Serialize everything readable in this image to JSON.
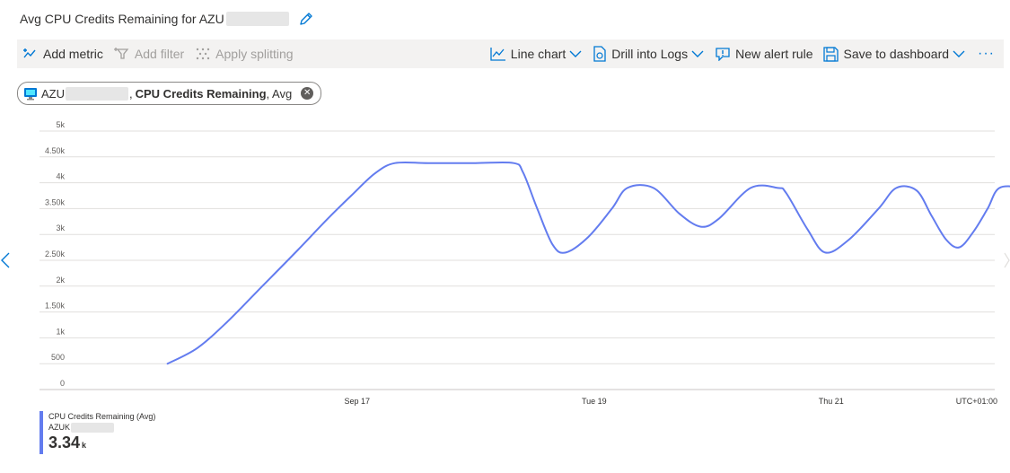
{
  "header": {
    "title": "Avg CPU Credits Remaining for AZU",
    "edit_icon": "pencil-icon"
  },
  "toolbar": {
    "add_metric": "Add metric",
    "add_filter": "Add filter",
    "apply_splitting": "Apply splitting",
    "line_chart": "Line chart",
    "drill_logs": "Drill into Logs",
    "new_alert": "New alert rule",
    "save_dashboard": "Save to dashboard",
    "more": "···"
  },
  "pill": {
    "resource": "AZU",
    "sep": ",",
    "metric": "CPU Credits Remaining",
    "agg": ", Avg"
  },
  "colors": {
    "series": "#637cef",
    "accent": "#0078d4",
    "grid": "#e1dfdd"
  },
  "chart_data": {
    "type": "line",
    "y_ticks": [
      "0",
      "500",
      "1k",
      "1.50k",
      "2k",
      "2.50k",
      "3k",
      "3.50k",
      "4k",
      "4.50k",
      "5k"
    ],
    "ylim": [
      0,
      5000
    ],
    "x_ticks": [
      {
        "label": "Sep 17",
        "x": 1.0
      },
      {
        "label": "Tue 19",
        "x": 3.0
      },
      {
        "label": "Thu 21",
        "x": 5.0
      }
    ],
    "xlim": [
      -1.68,
      6.38
    ],
    "timezone": "UTC+01:00",
    "series": [
      {
        "name": "CPU Credits Remaining (Avg)",
        "points": [
          [
            -0.6,
            500
          ],
          [
            -0.35,
            800
          ],
          [
            -0.1,
            1300
          ],
          [
            0.2,
            2000
          ],
          [
            0.5,
            2700
          ],
          [
            0.75,
            3300
          ],
          [
            0.95,
            3750
          ],
          [
            1.15,
            4180
          ],
          [
            1.32,
            4380
          ],
          [
            1.6,
            4380
          ],
          [
            2.0,
            4380
          ],
          [
            2.32,
            4380
          ],
          [
            2.4,
            4200
          ],
          [
            2.52,
            3500
          ],
          [
            2.65,
            2800
          ],
          [
            2.76,
            2650
          ],
          [
            2.95,
            2950
          ],
          [
            3.15,
            3500
          ],
          [
            3.28,
            3900
          ],
          [
            3.5,
            3900
          ],
          [
            3.72,
            3400
          ],
          [
            3.9,
            3150
          ],
          [
            4.05,
            3300
          ],
          [
            4.32,
            3900
          ],
          [
            4.55,
            3900
          ],
          [
            4.62,
            3800
          ],
          [
            4.8,
            3100
          ],
          [
            4.95,
            2650
          ],
          [
            5.15,
            2900
          ],
          [
            5.4,
            3500
          ],
          [
            5.55,
            3900
          ],
          [
            5.72,
            3850
          ],
          [
            5.85,
            3350
          ],
          [
            5.97,
            2900
          ],
          [
            6.08,
            2750
          ],
          [
            6.2,
            3050
          ],
          [
            6.32,
            3500
          ],
          [
            6.42,
            3900
          ],
          [
            6.62,
            3900
          ],
          [
            6.7,
            3850
          ]
        ]
      }
    ],
    "legend": {
      "series": "CPU Credits Remaining (Avg)",
      "resource": "AZUK",
      "value": "3.34",
      "unit": "k"
    }
  }
}
